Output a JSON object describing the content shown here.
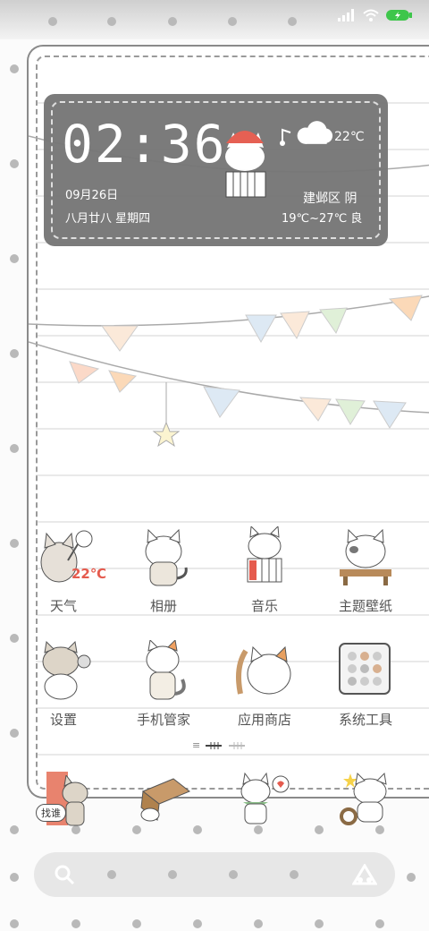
{
  "clock": {
    "time": "02:36",
    "date": "09月26日",
    "lunar": "八月廿八  星期四"
  },
  "weather": {
    "temp": "22℃",
    "location": "建邺区  阴",
    "range": "19℃~27℃ 良"
  },
  "apps": [
    {
      "label": "天气",
      "badge": "22℃"
    },
    {
      "label": "相册"
    },
    {
      "label": "音乐"
    },
    {
      "label": "主题壁纸"
    },
    {
      "label": "设置"
    },
    {
      "label": "手机管家"
    },
    {
      "label": "应用商店"
    },
    {
      "label": "系统工具"
    }
  ],
  "dock": {
    "first_label": "找谁"
  },
  "colors": {
    "widget": "#777777",
    "accent": "#e8836e",
    "battery": "#3ec64b"
  }
}
